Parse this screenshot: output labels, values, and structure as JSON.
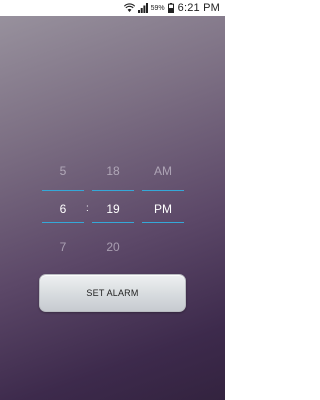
{
  "status_bar": {
    "battery_percent": "59%",
    "time": "6:21 PM",
    "icons": [
      "wifi-icon",
      "signal-icon",
      "battery-icon"
    ]
  },
  "time_picker": {
    "hour": {
      "previous": "5",
      "selected": "6",
      "next": "7"
    },
    "separator": ":",
    "minute": {
      "previous": "18",
      "selected": "19",
      "next": "20"
    },
    "ampm": {
      "previous": "AM",
      "selected": "PM",
      "next": ""
    },
    "accent_color": "#35a8d8"
  },
  "actions": {
    "set_alarm_label": "SET ALARM"
  }
}
